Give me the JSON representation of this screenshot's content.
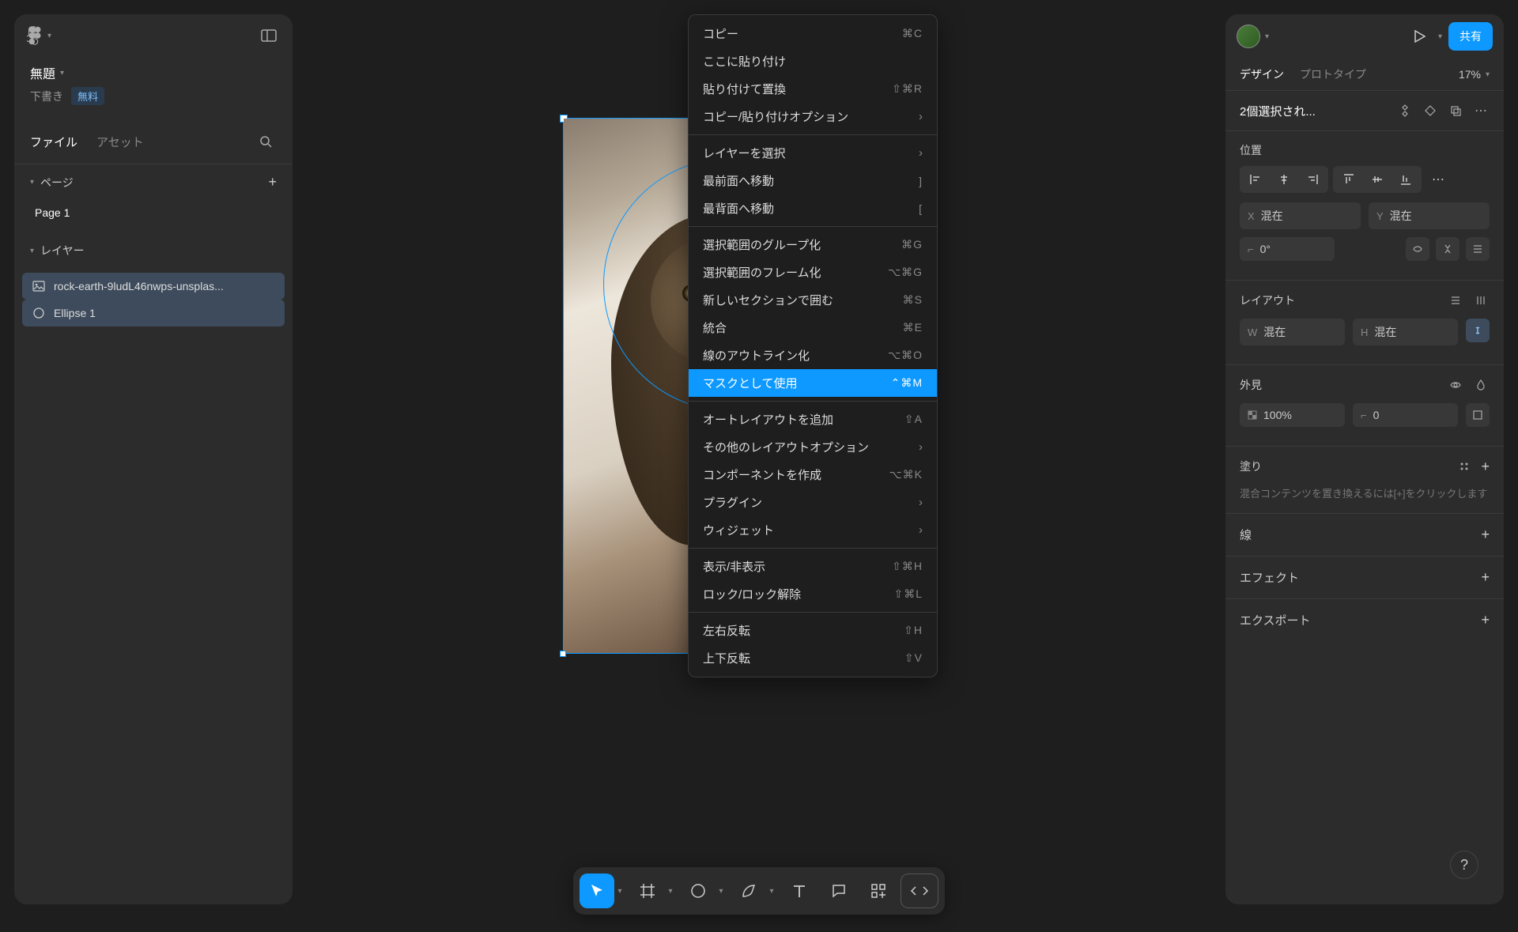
{
  "file": {
    "title": "無題",
    "status": "下書き",
    "plan_badge": "無料"
  },
  "left_tabs": {
    "file": "ファイル",
    "asset": "アセット"
  },
  "pages": {
    "section_label": "ページ",
    "items": [
      "Page 1"
    ]
  },
  "layers": {
    "section_label": "レイヤー",
    "items": [
      {
        "name": "rock-earth-9ludL46nwps-unsplas...",
        "icon": "image"
      },
      {
        "name": "Ellipse 1",
        "icon": "ellipse"
      }
    ]
  },
  "selection_size": "1920",
  "context_menu": {
    "groups": [
      [
        {
          "label": "コピー",
          "shortcut": "⌘C"
        },
        {
          "label": "ここに貼り付け",
          "shortcut": ""
        },
        {
          "label": "貼り付けて置換",
          "shortcut": "⇧⌘R"
        },
        {
          "label": "コピー/貼り付けオプション",
          "submenu": true
        }
      ],
      [
        {
          "label": "レイヤーを選択",
          "submenu": true
        },
        {
          "label": "最前面へ移動",
          "shortcut": "]"
        },
        {
          "label": "最背面へ移動",
          "shortcut": "["
        }
      ],
      [
        {
          "label": "選択範囲のグループ化",
          "shortcut": "⌘G"
        },
        {
          "label": "選択範囲のフレーム化",
          "shortcut": "⌥⌘G"
        },
        {
          "label": "新しいセクションで囲む",
          "shortcut": "⌘S"
        },
        {
          "label": "統合",
          "shortcut": "⌘E"
        },
        {
          "label": "線のアウトライン化",
          "shortcut": "⌥⌘O"
        },
        {
          "label": "マスクとして使用",
          "shortcut": "⌃⌘M",
          "highlighted": true
        }
      ],
      [
        {
          "label": "オートレイアウトを追加",
          "shortcut": "⇧A"
        },
        {
          "label": "その他のレイアウトオプション",
          "submenu": true
        },
        {
          "label": "コンポーネントを作成",
          "shortcut": "⌥⌘K"
        },
        {
          "label": "プラグイン",
          "submenu": true
        },
        {
          "label": "ウィジェット",
          "submenu": true
        }
      ],
      [
        {
          "label": "表示/非表示",
          "shortcut": "⇧⌘H"
        },
        {
          "label": "ロック/ロック解除",
          "shortcut": "⇧⌘L"
        }
      ],
      [
        {
          "label": "左右反転",
          "shortcut": "⇧H"
        },
        {
          "label": "上下反転",
          "shortcut": "⇧V"
        }
      ]
    ]
  },
  "right": {
    "share": "共有",
    "tabs": {
      "design": "デザイン",
      "prototype": "プロトタイプ"
    },
    "zoom": "17%",
    "selection_title": "2個選択され...",
    "position": {
      "label": "位置",
      "x_prefix": "X",
      "x": "混在",
      "y_prefix": "Y",
      "y": "混在",
      "rot_prefix": "⟀",
      "rot": "0°"
    },
    "layout": {
      "label": "レイアウト",
      "w_prefix": "W",
      "w": "混在",
      "h_prefix": "H",
      "h": "混在"
    },
    "appearance": {
      "label": "外見",
      "opacity": "100%",
      "radius": "0"
    },
    "fill": {
      "label": "塗り",
      "hint": "混合コンテンツを置き換えるには[+]をクリックします"
    },
    "stroke": "線",
    "effect": "エフェクト",
    "export": "エクスポート"
  },
  "help": "?"
}
